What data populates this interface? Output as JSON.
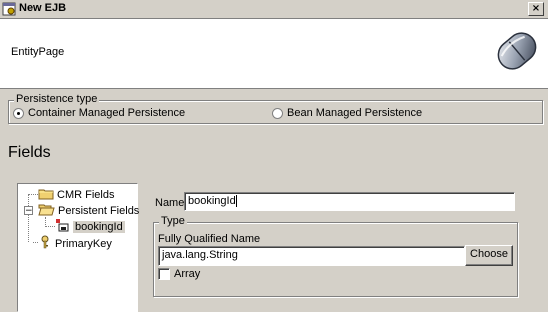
{
  "window": {
    "title": "New EJB",
    "close_glyph": "×"
  },
  "banner": {
    "page_name": "EntityPage",
    "graphic": "ejb-bean-icon"
  },
  "persistence": {
    "legend": "Persistence type",
    "options": [
      {
        "label": "Container Managed Persistence",
        "selected": true
      },
      {
        "label": "Bean Managed Persistence",
        "selected": false
      }
    ]
  },
  "fields": {
    "title": "Fields",
    "tree": [
      {
        "label": "CMR Fields",
        "icon": "folder-icon",
        "expander": ""
      },
      {
        "label": "Persistent Fields",
        "icon": "open-folder-icon",
        "expander": "−"
      },
      {
        "label": "bookingId",
        "icon": "field-icon",
        "expander": "",
        "selected": true
      },
      {
        "label": "PrimaryKey",
        "icon": "key-icon",
        "expander": ""
      }
    ]
  },
  "detail": {
    "name_label": "Name",
    "name_value": "bookingId",
    "type_legend": "Type",
    "fqn_label": "Fully Qualified Name",
    "fqn_value": "java.lang.String",
    "choose_label": "Choose",
    "array_label": "Array",
    "array_checked": false
  }
}
